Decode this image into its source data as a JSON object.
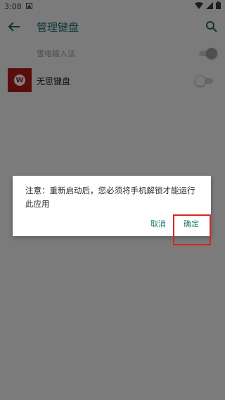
{
  "status_bar": {
    "time": "3:08"
  },
  "toolbar": {
    "title": "管理键盘"
  },
  "keyboards": [
    {
      "label": "雪电输入法",
      "enabled": true
    },
    {
      "label": "无思键盘",
      "enabled": false
    }
  ],
  "dialog": {
    "message": "注意：重新启动后，您必须将手机解锁才能运行此应用",
    "cancel_label": "取消",
    "ok_label": "确定"
  },
  "colors": {
    "accent": "#1e7b73",
    "highlight": "#e02020",
    "app_icon": "#b21c1c"
  }
}
